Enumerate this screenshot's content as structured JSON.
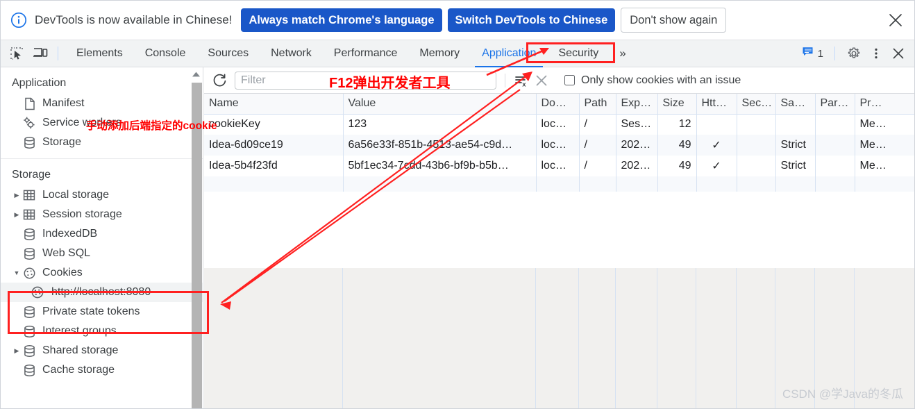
{
  "notice": {
    "icon": "info-circle-icon",
    "message": "DevTools is now available in Chinese!",
    "primary_button": "Always match Chrome's language",
    "secondary_button": "Switch DevTools to Chinese",
    "dismiss_button": "Don't show again",
    "close_icon": "close-icon",
    "accent_color": "#1a57c8"
  },
  "tabbar": {
    "inspect_icon": "inspect-element-icon",
    "device_icon": "device-toolbar-icon",
    "tabs": [
      {
        "label": "Elements",
        "active": false
      },
      {
        "label": "Console",
        "active": false
      },
      {
        "label": "Sources",
        "active": false
      },
      {
        "label": "Network",
        "active": false
      },
      {
        "label": "Performance",
        "active": false
      },
      {
        "label": "Memory",
        "active": false
      },
      {
        "label": "Application",
        "active": true
      },
      {
        "label": "Security",
        "active": false
      }
    ],
    "more_tabs": "»",
    "issues_icon": "issues-message-icon",
    "issues_count": "1",
    "settings_icon": "gear-icon",
    "menu_icon": "kebab-menu-icon",
    "close_icon": "close-icon",
    "active_color": "#1a73e8"
  },
  "sidebar": {
    "application": {
      "title": "Application",
      "items": [
        {
          "label": "Manifest",
          "icon": "manifest-file-icon",
          "expandable": false,
          "selected": false
        },
        {
          "label": "Service workers",
          "icon": "service-workers-gears-icon",
          "expandable": false,
          "selected": false
        },
        {
          "label": "Storage",
          "icon": "storage-database-icon",
          "expandable": false,
          "selected": false
        }
      ]
    },
    "storage": {
      "title": "Storage",
      "items": [
        {
          "label": "Local storage",
          "icon": "table-grid-icon",
          "expandable": true,
          "expanded": false,
          "selected": false,
          "child": false
        },
        {
          "label": "Session storage",
          "icon": "table-grid-icon",
          "expandable": true,
          "expanded": false,
          "selected": false,
          "child": false
        },
        {
          "label": "IndexedDB",
          "icon": "storage-database-icon",
          "expandable": false,
          "expanded": false,
          "selected": false,
          "child": false
        },
        {
          "label": "Web SQL",
          "icon": "storage-database-icon",
          "expandable": false,
          "expanded": false,
          "selected": false,
          "child": false
        },
        {
          "label": "Cookies",
          "icon": "cookie-icon",
          "expandable": true,
          "expanded": true,
          "selected": false,
          "child": false
        },
        {
          "label": "http://localhost:8080",
          "icon": "cookie-icon",
          "expandable": false,
          "expanded": false,
          "selected": true,
          "child": true
        },
        {
          "label": "Private state tokens",
          "icon": "storage-database-icon",
          "expandable": false,
          "expanded": false,
          "selected": false,
          "child": false
        },
        {
          "label": "Interest groups",
          "icon": "storage-database-icon",
          "expandable": false,
          "expanded": false,
          "selected": false,
          "child": false
        },
        {
          "label": "Shared storage",
          "icon": "storage-database-icon",
          "expandable": true,
          "expanded": false,
          "selected": false,
          "child": false
        },
        {
          "label": "Cache storage",
          "icon": "storage-database-icon",
          "expandable": false,
          "expanded": false,
          "selected": false,
          "child": false
        }
      ]
    },
    "scroll_up_icon": "scroll-up-arrow-icon"
  },
  "toolbar": {
    "refresh_icon": "refresh-icon",
    "filter_placeholder": "Filter",
    "filter_value": "",
    "clear_filter_icon": "clear-list-icon",
    "delete_icon": "delete-cookie-icon",
    "checkbox_label": "Only show cookies with an issue",
    "checkbox_checked": false
  },
  "table": {
    "columns": [
      "Name",
      "Value",
      "Do…",
      "Path",
      "Exp…",
      "Size",
      "Htt…",
      "Sec…",
      "Sa…",
      "Par…",
      "Pr…"
    ],
    "rows": [
      {
        "name": "cookieKey",
        "value": "123",
        "domain": "loc…",
        "path": "/",
        "expires": "Ses…",
        "size": "12",
        "http_only": "",
        "secure": "",
        "same_site": "",
        "partition_key": "",
        "priority": "Me…"
      },
      {
        "name": "Idea-6d09ce19",
        "value": "6a56e33f-851b-4513-ae54-c9d…",
        "domain": "loc…",
        "path": "/",
        "expires": "202…",
        "size": "49",
        "http_only": "✓",
        "secure": "",
        "same_site": "Strict",
        "partition_key": "",
        "priority": "Me…"
      },
      {
        "name": "Idea-5b4f23fd",
        "value": "5bf1ec34-7cdd-43b6-bf9b-b5b…",
        "domain": "loc…",
        "path": "/",
        "expires": "202…",
        "size": "49",
        "http_only": "✓",
        "secure": "",
        "same_site": "Strict",
        "partition_key": "",
        "priority": "Me…"
      }
    ]
  },
  "annotations": {
    "cookie_note": "手动添加后端指定的cookie",
    "f12_note": "F12弹出开发者工具",
    "color": "#ff0000"
  },
  "watermark": "CSDN @学Java的冬瓜"
}
